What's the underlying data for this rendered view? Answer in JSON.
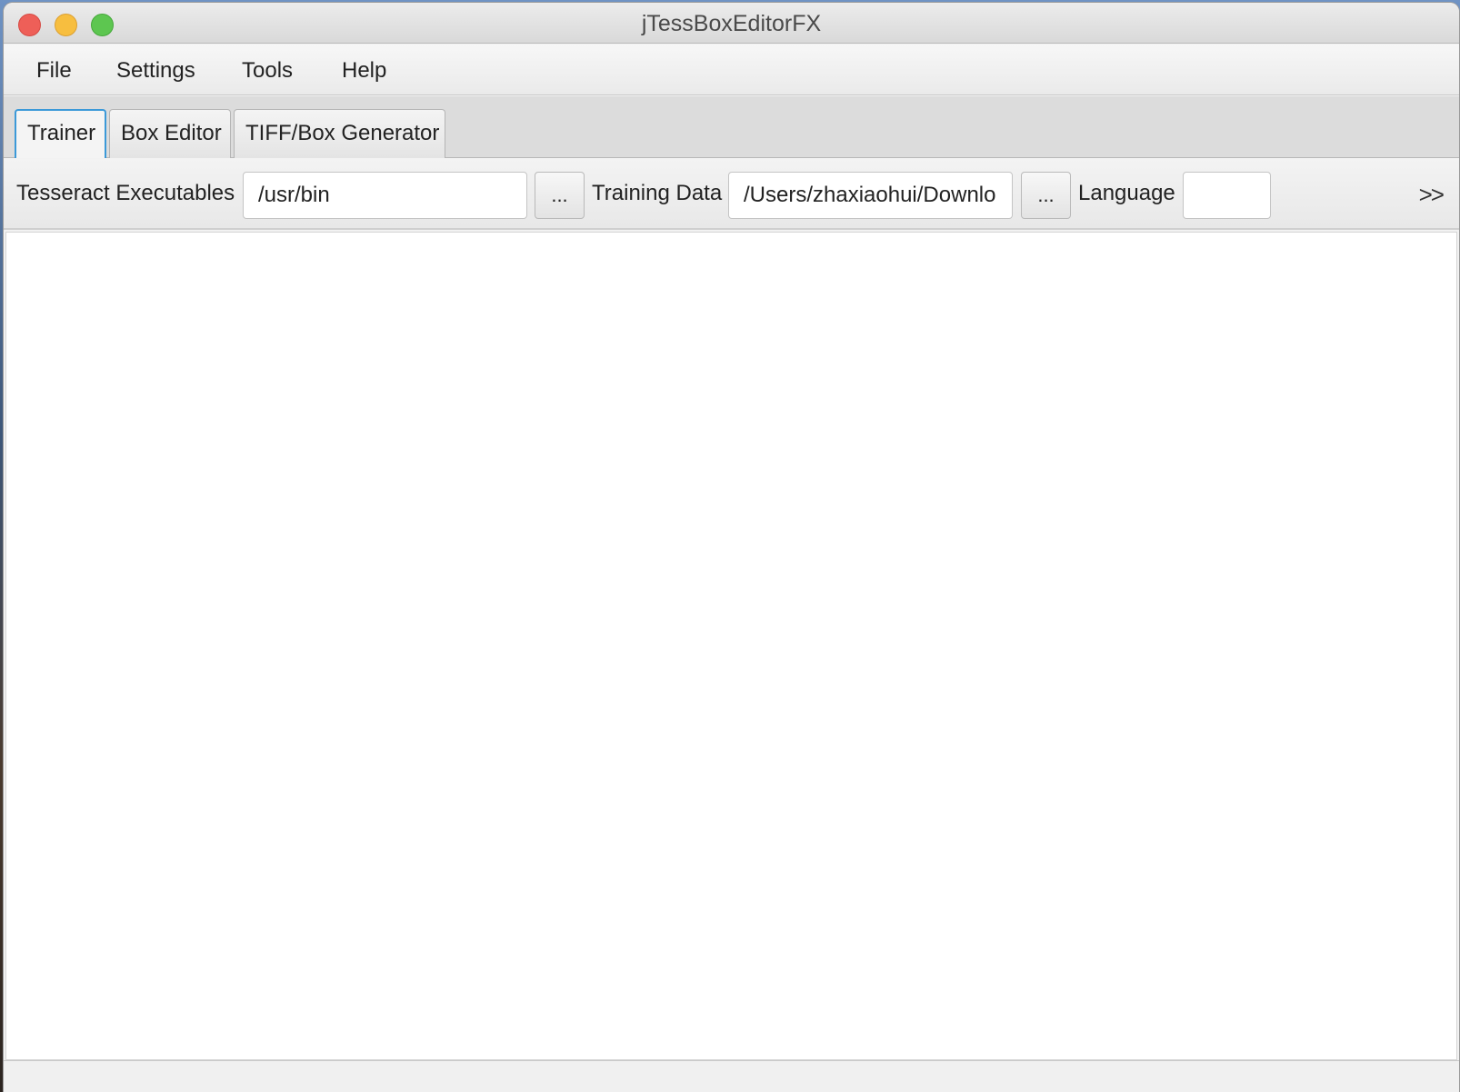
{
  "window": {
    "title": "jTessBoxEditorFX"
  },
  "menubar": {
    "items": [
      {
        "label": "File"
      },
      {
        "label": "Settings"
      },
      {
        "label": "Tools"
      },
      {
        "label": "Help"
      }
    ]
  },
  "tabs": [
    {
      "label": "Trainer",
      "active": true
    },
    {
      "label": "Box Editor",
      "active": false
    },
    {
      "label": "TIFF/Box Generator",
      "active": false
    }
  ],
  "toolbar": {
    "tesseract_label": "Tesseract Executables",
    "tesseract_value": "/usr/bin",
    "tesseract_browse": "...",
    "training_label": "Training Data",
    "training_value": "/Users/zhaxiaohui/Downlo",
    "training_browse": "...",
    "language_label": "Language",
    "language_value": "",
    "overflow": ">>"
  },
  "icons": {
    "close": "close-icon",
    "minimize": "minimize-icon",
    "maximize": "maximize-icon",
    "overflow": "chevron-double-right-icon"
  },
  "colors": {
    "close": "#ee5f58",
    "minimize": "#f7be3f",
    "maximize": "#5dc650",
    "tab_focus": "#3b99d8"
  }
}
